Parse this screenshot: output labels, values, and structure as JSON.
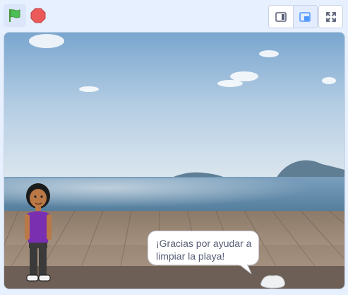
{
  "toolbar": {
    "green_flag_icon": "green-flag-icon",
    "stop_icon": "stop-sign-icon",
    "small_stage_icon": "small-stage-icon",
    "large_stage_icon": "large-stage-icon",
    "fullscreen_icon": "fullscreen-icon",
    "accent": "#4c97ff",
    "flag_color": "#4cbf56",
    "stop_color": "#ec5959"
  },
  "stage": {
    "backdrop": "beach boardwalk",
    "speech_bubble": "¡Gracias por ayudar a limpiar la playa!"
  }
}
